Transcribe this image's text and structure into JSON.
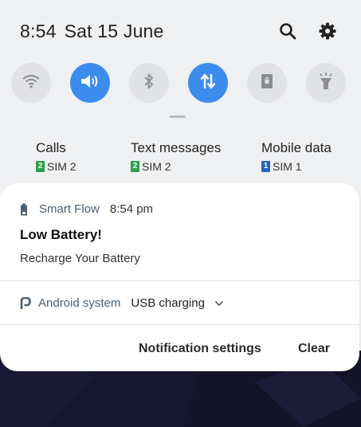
{
  "status": {
    "time": "8:54",
    "date": "Sat 15 June"
  },
  "header_icons": [
    "search-icon",
    "gear-icon"
  ],
  "quick_toggles": [
    {
      "name": "wifi",
      "icon": "wifi-icon",
      "active": false
    },
    {
      "name": "sound",
      "icon": "sound-icon",
      "active": true
    },
    {
      "name": "bluetooth",
      "icon": "bluetooth-icon",
      "active": false
    },
    {
      "name": "mobile-data",
      "icon": "data-arrows-icon",
      "active": true
    },
    {
      "name": "screen-lock",
      "icon": "lock-screen-icon",
      "active": false
    },
    {
      "name": "flashlight",
      "icon": "flashlight-icon",
      "active": false
    }
  ],
  "sim_prefs": [
    {
      "label": "Calls",
      "sim_num": "2",
      "sim_text": "SIM 2",
      "color": "#2e9f4c"
    },
    {
      "label": "Text messages",
      "sim_num": "2",
      "sim_text": "SIM 2",
      "color": "#2e9f4c"
    },
    {
      "label": "Mobile data",
      "sim_num": "1",
      "sim_text": "SIM 1",
      "color": "#2a63b8"
    }
  ],
  "notification": {
    "app": "Smart Flow",
    "time": "8:54 pm",
    "title": "Low Battery!",
    "body": "Recharge Your Battery"
  },
  "system_notification": {
    "app": "Android system",
    "message": "USB charging"
  },
  "actions": {
    "settings": "Notification settings",
    "clear": "Clear"
  },
  "colors": {
    "accent": "#3c8ced",
    "toggle_off": "#e1e2e4",
    "panel_bg": "#eff0f2"
  }
}
